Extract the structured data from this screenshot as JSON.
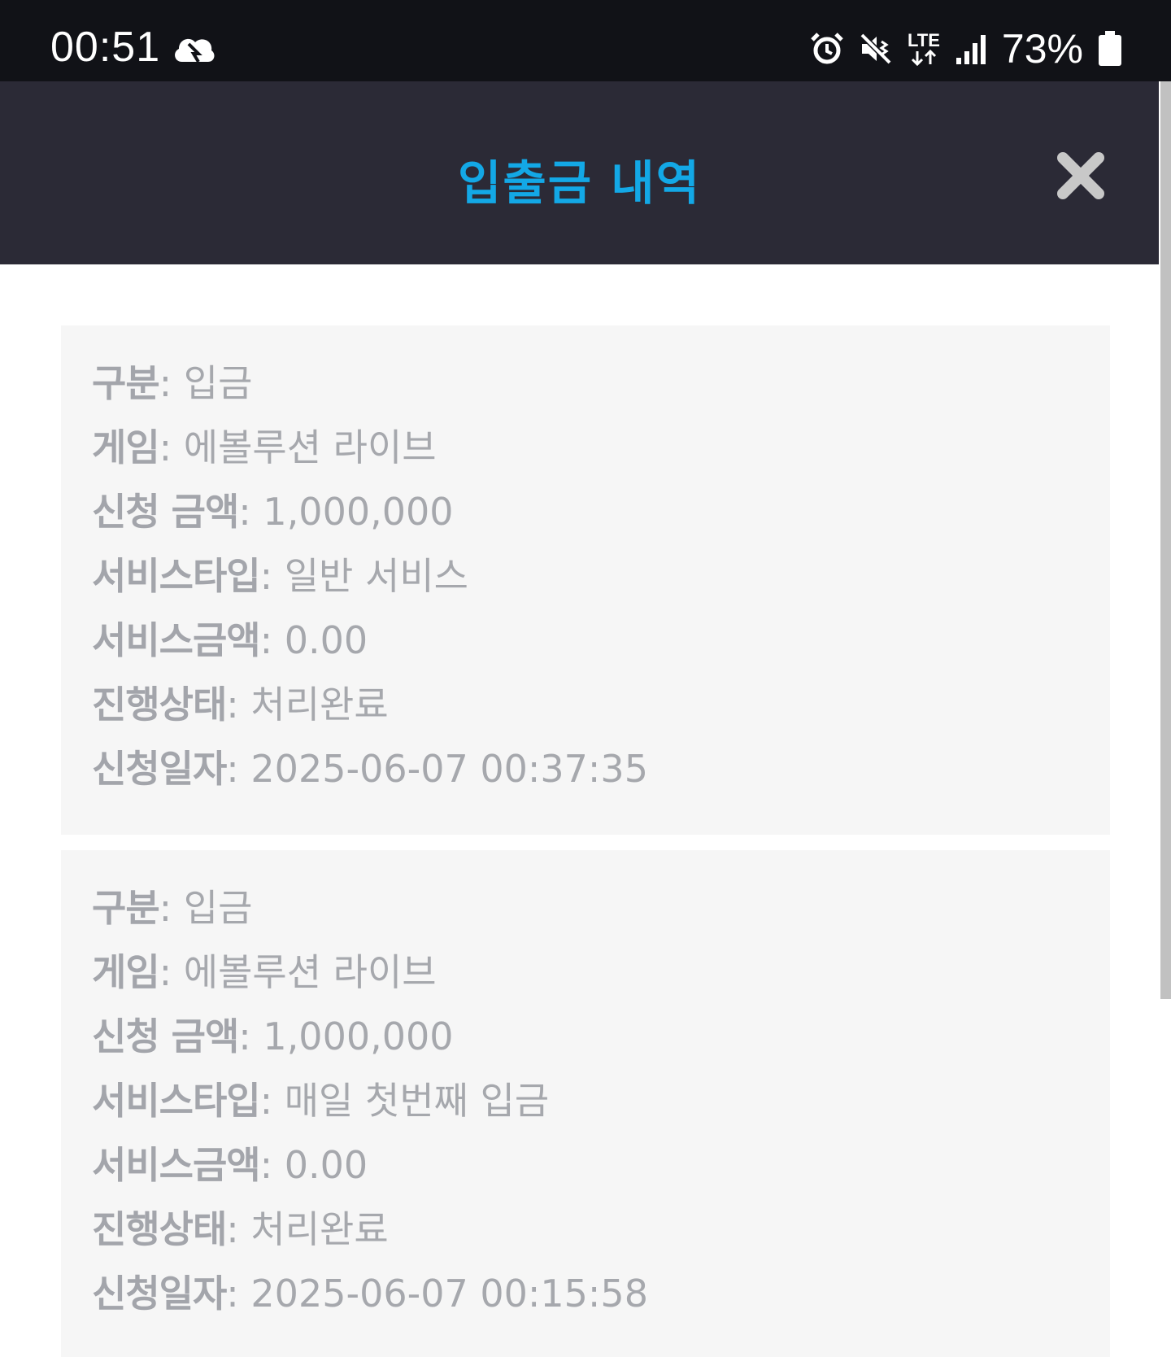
{
  "status_bar": {
    "time": "00:51",
    "network": "LTE",
    "battery": "73%"
  },
  "modal": {
    "title": "입출금 내역"
  },
  "records": [
    {
      "type_label": "구분",
      "type_value": "입금",
      "game_label": "게임",
      "game_value": "에볼루션 라이브",
      "amount_label": "신청 금액",
      "amount_value": "1,000,000",
      "service_type_label": "서비스타입",
      "service_type_value": "일반 서비스",
      "service_amount_label": "서비스금액",
      "service_amount_value": "0.00",
      "status_label": "진행상태",
      "status_value": "처리완료",
      "date_label": "신청일자",
      "date_value": "2025-06-07 00:37:35"
    },
    {
      "type_label": "구분",
      "type_value": "입금",
      "game_label": "게임",
      "game_value": "에볼루션 라이브",
      "amount_label": "신청 금액",
      "amount_value": "1,000,000",
      "service_type_label": "서비스타입",
      "service_type_value": "매일 첫번째 입금",
      "service_amount_label": "서비스금액",
      "service_amount_value": "0.00",
      "status_label": "진행상태",
      "status_value": "처리완료",
      "date_label": "신청일자",
      "date_value": "2025-06-07 00:15:58"
    }
  ],
  "colors": {
    "header_bg": "#2b2a36",
    "title": "#13a8e6",
    "status_bg": "#111217",
    "card_bg": "#f6f6f6",
    "text": "#9b9ea4"
  }
}
